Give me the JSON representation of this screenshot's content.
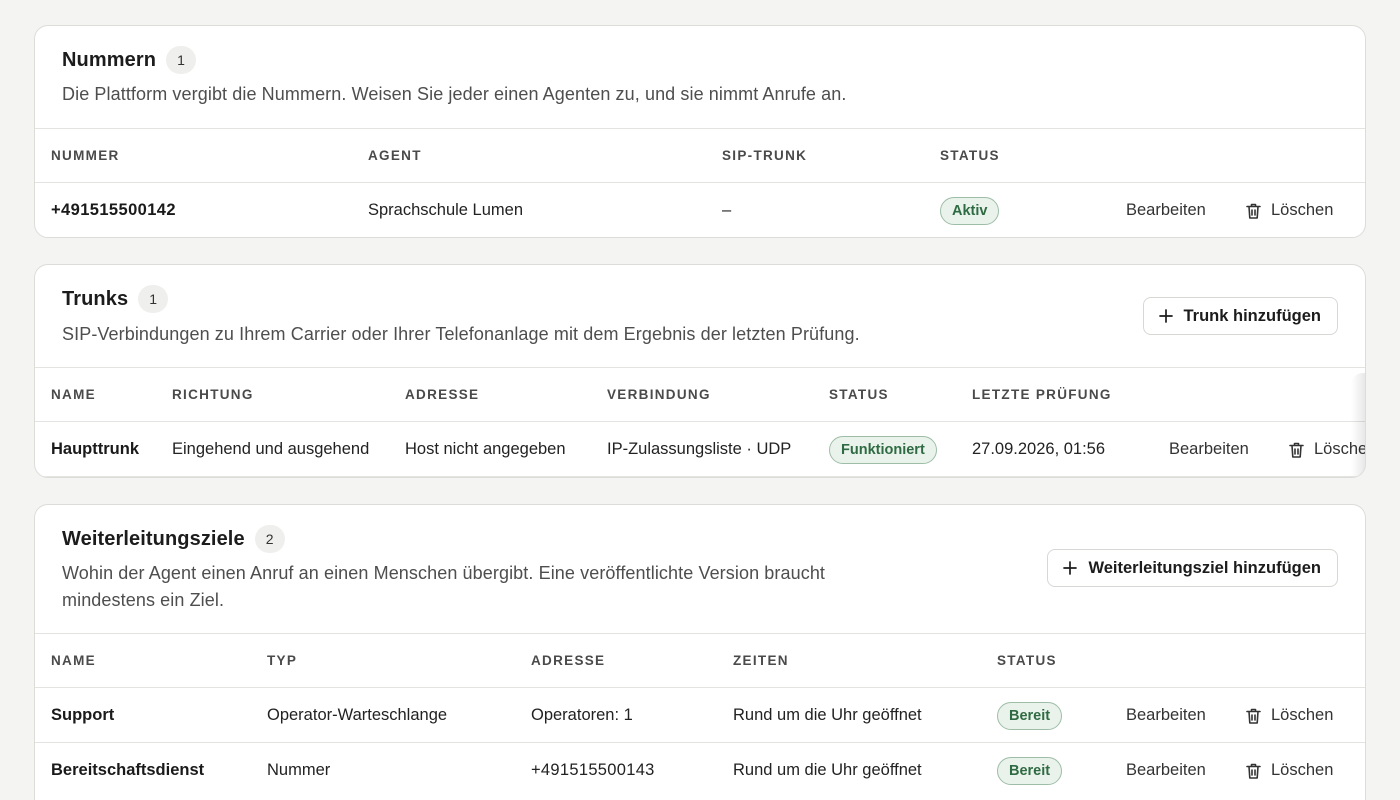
{
  "numbers": {
    "title": "Nummern",
    "count": "1",
    "description": "Die Plattform vergibt die Nummern. Weisen Sie jeder einen Agenten zu, und sie nimmt Anrufe an.",
    "columns": [
      "Nummer",
      "Agent",
      "SIP-Trunk",
      "Status"
    ],
    "rows": [
      {
        "number": "+491515500142",
        "agent": "Sprachschule Lumen",
        "trunk": "–",
        "status": "Aktiv",
        "edit": "Bearbeiten",
        "delete": "Löschen"
      }
    ]
  },
  "trunks": {
    "title": "Trunks",
    "count": "1",
    "description": "SIP-Verbindungen zu Ihrem Carrier oder Ihrer Telefonanlage mit dem Ergebnis der letzten Prüfung.",
    "add_label": "Trunk hinzufügen",
    "columns": [
      "Name",
      "Richtung",
      "Adresse",
      "Verbindung",
      "Status",
      "Letzte Prüfung"
    ],
    "rows": [
      {
        "name": "Haupttrunk",
        "direction": "Eingehend und ausgehend",
        "address": "Host nicht angegeben",
        "connection": "IP-Zulassungsliste · UDP",
        "status": "Funktioniert",
        "last_check": "27.09.2026, 01:56",
        "edit": "Bearbeiten",
        "delete": "Lösche"
      }
    ]
  },
  "forwarding": {
    "title": "Weiterleitungsziele",
    "count": "2",
    "description": "Wohin der Agent einen Anruf an einen Menschen übergibt. Eine veröffentlichte Version braucht mindestens ein Ziel.",
    "add_label": "Weiterleitungsziel hinzufügen",
    "columns": [
      "Name",
      "Typ",
      "Adresse",
      "Zeiten",
      "Status"
    ],
    "rows": [
      {
        "name": "Support",
        "type": "Operator-Warteschlange",
        "address": "Operatoren: 1",
        "times": "Rund um die Uhr geöffnet",
        "status": "Bereit",
        "edit": "Bearbeiten",
        "delete": "Löschen"
      },
      {
        "name": "Bereitschaftsdienst",
        "type": "Nummer",
        "address": "+491515500143",
        "times": "Rund um die Uhr geöffnet",
        "status": "Bereit",
        "edit": "Bearbeiten",
        "delete": "Löschen"
      }
    ]
  },
  "icons": {
    "add": "plus-icon",
    "delete": "trash-icon"
  },
  "colors": {
    "status_text": "#2f6b42",
    "status_bg": "#eaf2ec",
    "status_border": "#9ebda7"
  }
}
